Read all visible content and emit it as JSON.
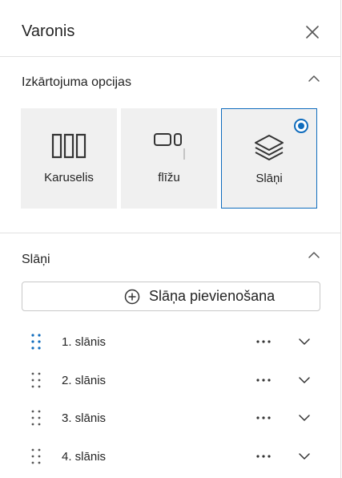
{
  "header": {
    "title": "Varonis"
  },
  "layout_section": {
    "title": "Izkārtojuma opcijas",
    "options": [
      {
        "label": "Karuselis",
        "icon": "carousel-icon",
        "selected": false
      },
      {
        "label": "flīžu",
        "icon": "tiles-icon",
        "selected": false
      },
      {
        "label": "Slāņi",
        "icon": "layers-icon",
        "selected": true
      }
    ]
  },
  "layers_section": {
    "title": "Slāņi",
    "add_label": "Slāņa pievienošana",
    "layers": [
      {
        "label": "1. slānis"
      },
      {
        "label": "2. slānis"
      },
      {
        "label": "3. slānis"
      },
      {
        "label": "4. slānis"
      }
    ]
  },
  "colors": {
    "accent": "#0f6cbd",
    "tile_bg": "#f0f0f0",
    "divider": "#e1e1e1"
  }
}
